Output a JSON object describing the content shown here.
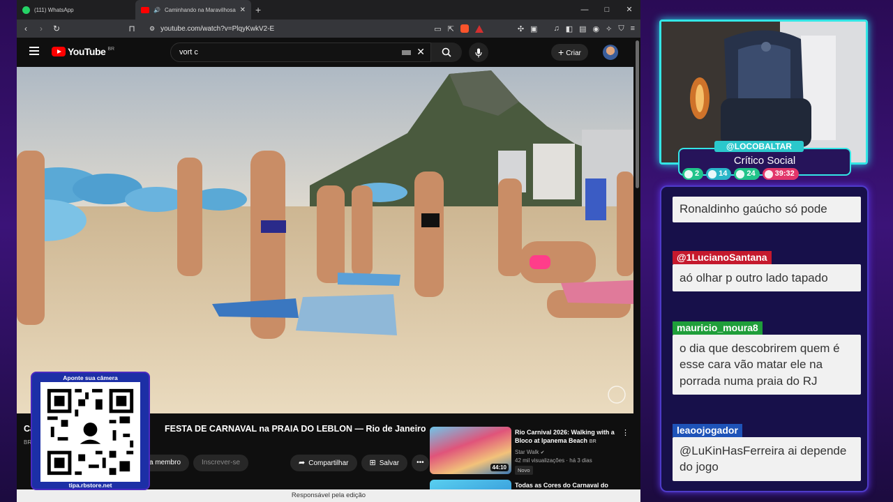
{
  "browser": {
    "tabs": [
      {
        "title": "(111) WhatsApp",
        "icon": "whatsapp-icon"
      },
      {
        "title": "Caminhando na Maravilhosa FESTA",
        "icon": "youtube-icon"
      }
    ],
    "new_tab": "+",
    "window_controls": {
      "minimize": "—",
      "maximize": "□",
      "close": "✕"
    },
    "url": "youtube.com/watch?v=PlqyKwkV2-E"
  },
  "youtube": {
    "logo": "YouTube",
    "region": "BR",
    "search_value": "vort c",
    "create_label": "Criar",
    "video_title_start": "Ca",
    "video_title_end": "FESTA DE CARNAVAL na PRAIA DO LEBLON — Rio de Janeiro",
    "channel_region": "BR",
    "buttons": {
      "member": "a membro",
      "subscribe": "Inscrever-se",
      "share": "Compartilhar",
      "save": "Salvar",
      "more": "•••"
    },
    "recommendations": [
      {
        "title": "Rio Carnival 2026: Walking with a Bloco at Ipanema Beach",
        "title_badge": "BR",
        "channel": "Star Walk",
        "views": "42 mil visualizações · há 3 dias",
        "badge": "Novo",
        "duration": "44:10"
      },
      {
        "title": "Todas as Cores do Carnaval do"
      }
    ],
    "status_text": "Responsável pela edição"
  },
  "qr_overlay": {
    "top_text": "Aponte sua câmera",
    "bottom_text": "tipa.rbstore.net"
  },
  "stream": {
    "handle": "@LOCOBALTAR",
    "subtitle": "Crítico Social",
    "stats": [
      {
        "icon": "chat-icon",
        "value": "2",
        "color": "#21c48a"
      },
      {
        "icon": "video-icon",
        "value": "14",
        "color": "#2ab7c8"
      },
      {
        "icon": "link-icon",
        "value": "24",
        "color": "#21c48a"
      },
      {
        "icon": "clock-icon",
        "value": "39:32",
        "color": "#e2366a"
      }
    ],
    "chat": [
      {
        "user": "",
        "text": "Ronaldinho gaúcho só pode"
      },
      {
        "user": "@1LucianoSantana",
        "user_color": "#c5192d",
        "text": "aó olhar p outro lado tapado"
      },
      {
        "user": "mauricio_moura8",
        "user_color": "#1f9e3a",
        "text": "o dia que descobrirem quem é esse cara vão matar ele na porrada numa praia do RJ"
      },
      {
        "user": "leaoojogador",
        "user_color": "#1e53b8",
        "text": "@LuKinHasFerreira ai depende do jogo"
      }
    ]
  }
}
